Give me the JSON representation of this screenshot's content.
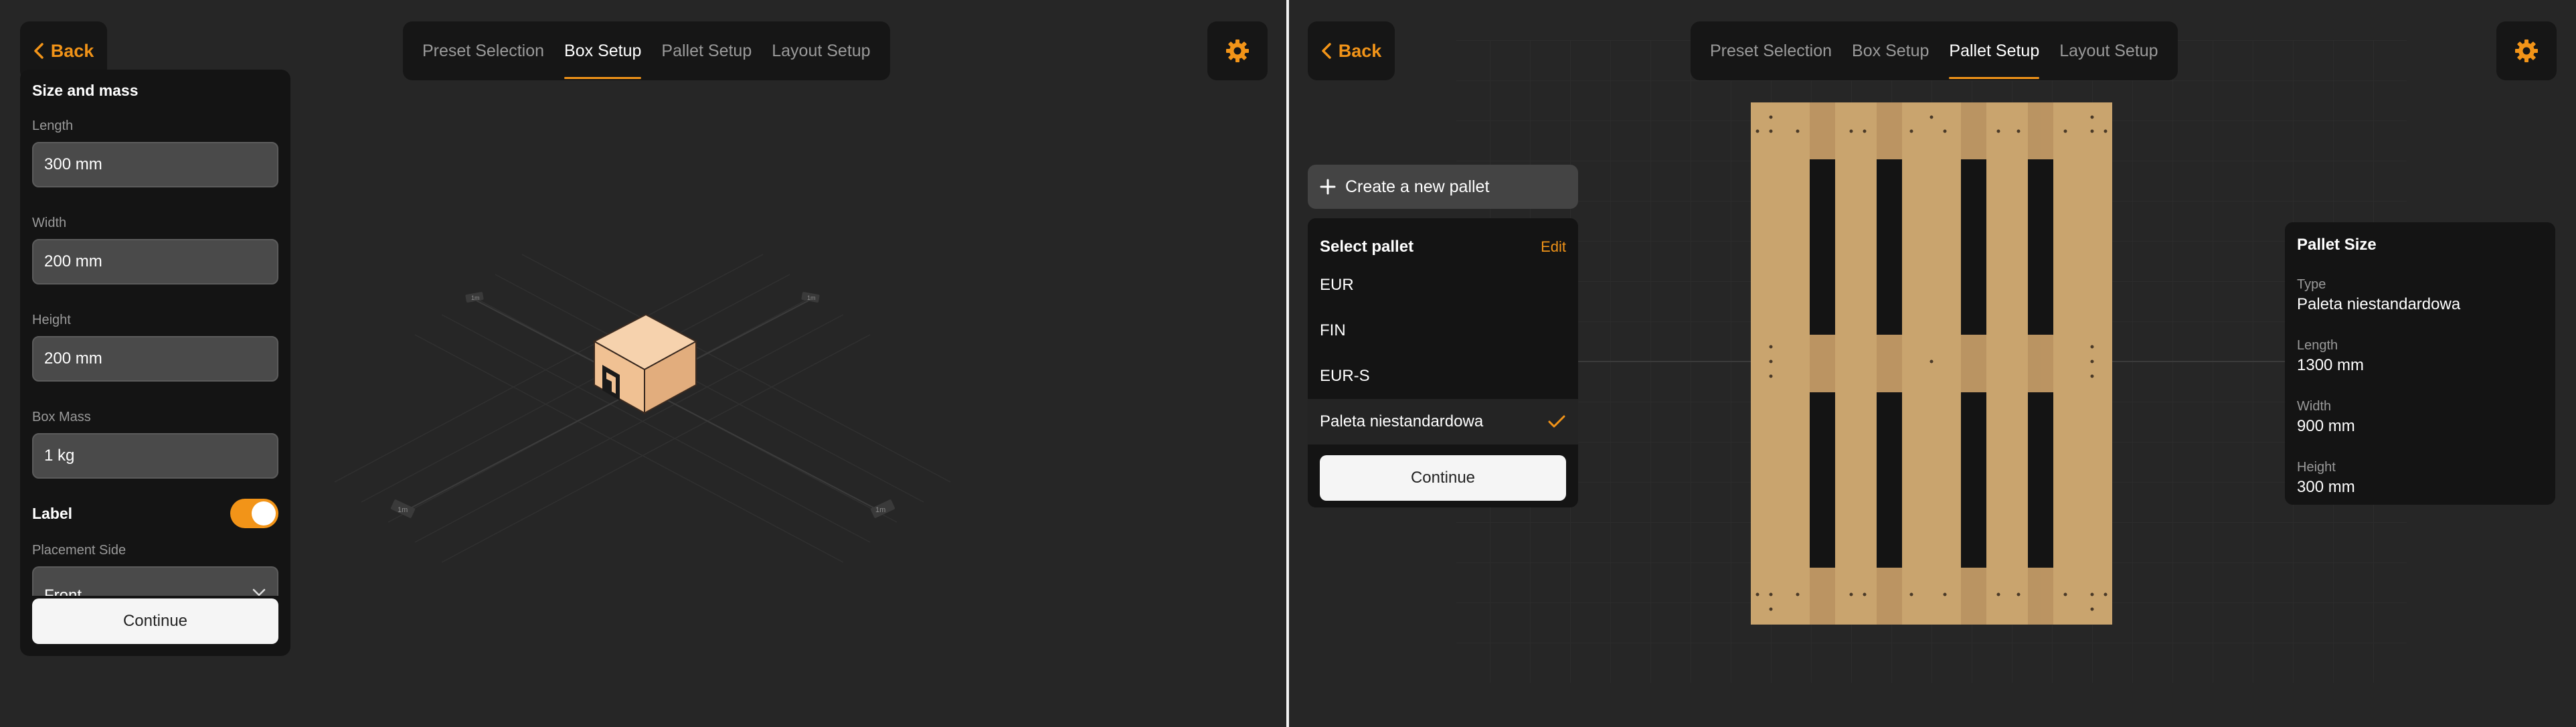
{
  "colors": {
    "accent": "#f29418",
    "background": "#262626",
    "panel": "#141414"
  },
  "left_screen": {
    "back_label": "Back",
    "tabs": [
      "Preset Selection",
      "Box Setup",
      "Pallet Setup",
      "Layout Setup"
    ],
    "active_tab": "Box Setup",
    "panel": {
      "title": "Size and mass",
      "fields": [
        {
          "label": "Length",
          "value": "300 mm"
        },
        {
          "label": "Width",
          "value": "200 mm"
        },
        {
          "label": "Height",
          "value": "200 mm"
        },
        {
          "label": "Box Mass",
          "value": "1 kg"
        }
      ],
      "label_toggle": {
        "label": "Label",
        "on": true
      },
      "placement_side_label": "Placement Side",
      "placement_side_value": "Front",
      "continue_label": "Continue"
    },
    "scene_markers": [
      "1m",
      "1m",
      "1m",
      "1m"
    ]
  },
  "right_screen": {
    "back_label": "Back",
    "tabs": [
      "Preset Selection",
      "Box Setup",
      "Pallet Setup",
      "Layout Setup"
    ],
    "active_tab": "Pallet Setup",
    "create_label": "Create a new pallet",
    "select_pallet": {
      "title": "Select pallet",
      "edit_label": "Edit",
      "items": [
        "EUR",
        "FIN",
        "EUR-S",
        "Paleta niestandardowa"
      ],
      "selected": "Paleta niestandardowa",
      "continue_label": "Continue"
    },
    "pallet_size": {
      "title": "Pallet Size",
      "type_label": "Type",
      "type_value": "Paleta niestandardowa",
      "length_label": "Length",
      "length_value": "1300 mm",
      "width_label": "Width",
      "width_value": "900 mm",
      "height_label": "Height",
      "height_value": "300 mm"
    }
  }
}
